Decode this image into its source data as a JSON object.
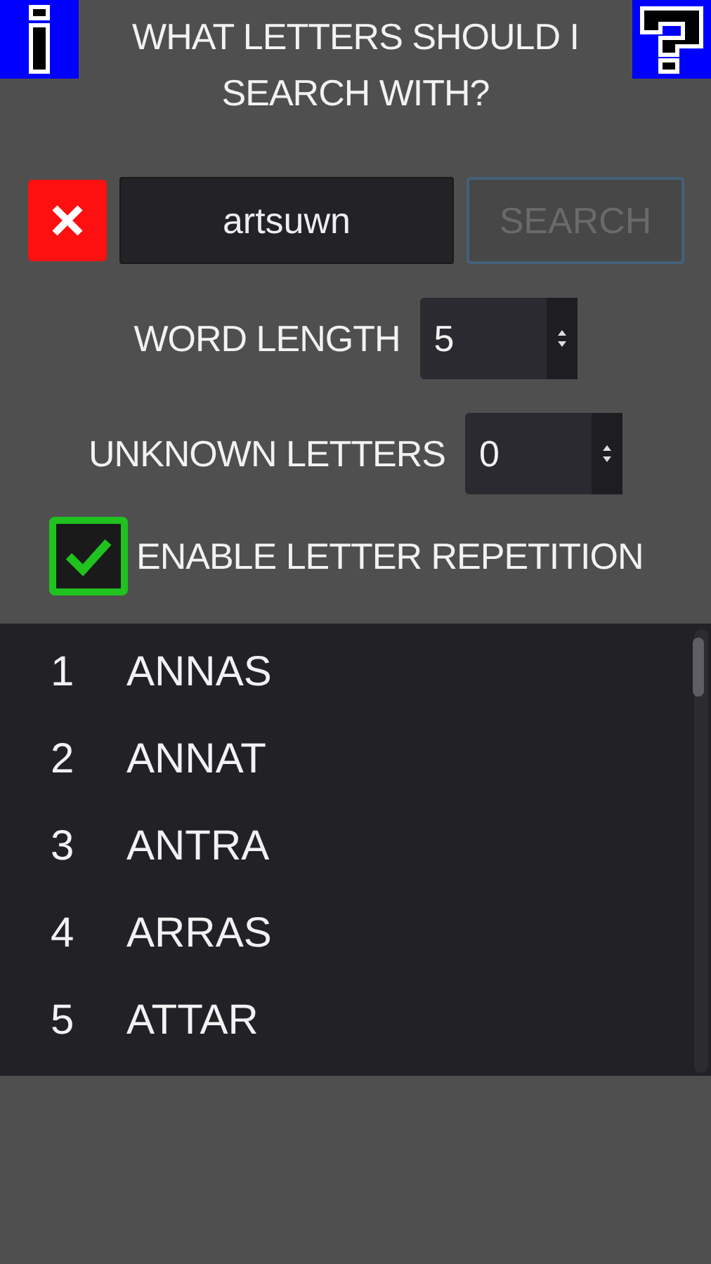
{
  "header": {
    "title": "WHAT LETTERS SHOULD I SEARCH WITH?"
  },
  "search": {
    "value": "artsuwn",
    "button": {
      "label": "SEARCH",
      "disabled": true
    }
  },
  "options": [
    {
      "label": "WORD LENGTH",
      "value": "5"
    },
    {
      "label": "UNKNOWN LETTERS",
      "value": "0"
    }
  ],
  "repetition": {
    "label": "ENABLE LETTER REPETITION",
    "checked": true
  },
  "results": [
    {
      "number": "1",
      "word": "ANNAS"
    },
    {
      "number": "2",
      "word": "ANNAT"
    },
    {
      "number": "3",
      "word": "ANTRA"
    },
    {
      "number": "4",
      "word": "ARRAS"
    },
    {
      "number": "5",
      "word": "ATTAR"
    }
  ]
}
